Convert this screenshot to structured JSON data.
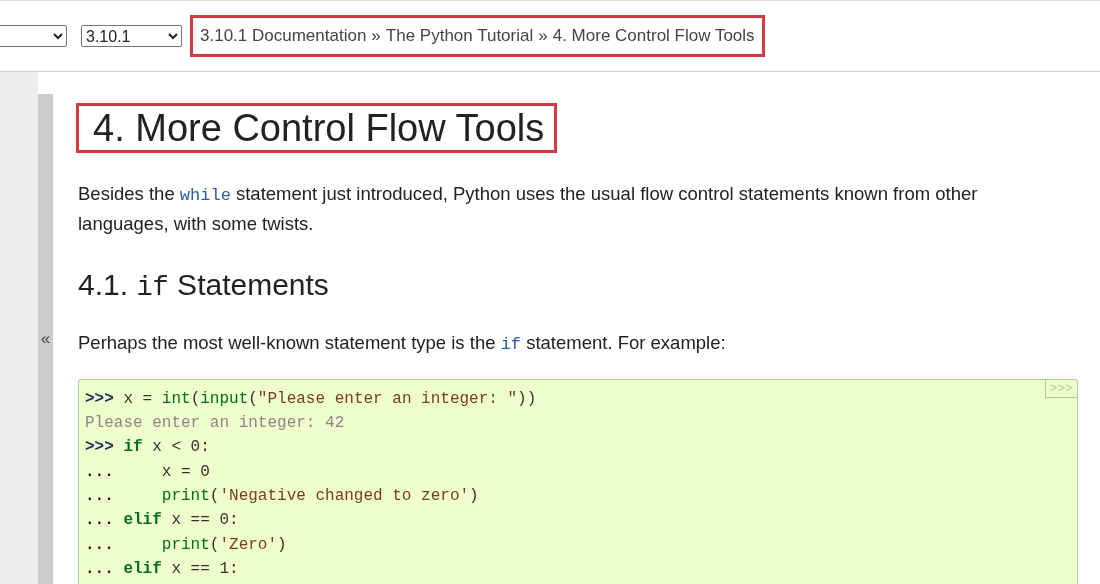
{
  "topbar": {
    "version_select": {
      "value": "3.10.1"
    },
    "breadcrumb": {
      "highlighted": true,
      "items": [
        "3.10.1 Documentation",
        "The Python Tutorial",
        "4. More Control Flow Tools"
      ],
      "separator": "»"
    }
  },
  "sidebar": {
    "collapse_button": "«"
  },
  "title": {
    "text": "4. More Control Flow Tools",
    "highlighted": true
  },
  "intro": [
    {
      "kind": "text",
      "text": "Besides the "
    },
    {
      "kind": "code",
      "text": "while"
    },
    {
      "kind": "text",
      "text": " statement just introduced, Python uses the usual flow control statements known from other languages, with some twists."
    }
  ],
  "section": {
    "number": "4.1.",
    "code": "if",
    "title": "Statements"
  },
  "para": [
    {
      "kind": "text",
      "text": "Perhaps the most well-known statement type is the "
    },
    {
      "kind": "code",
      "text": "if"
    },
    {
      "kind": "text",
      "text": " statement. For example:"
    }
  ],
  "code_block": {
    "copy_button": ">>>",
    "lines": [
      [
        {
          "kind": "prompt",
          "text": ">>> "
        },
        {
          "kind": "plain",
          "text": "x = "
        },
        {
          "kind": "builtin",
          "text": "int"
        },
        {
          "kind": "plain",
          "text": "("
        },
        {
          "kind": "builtin",
          "text": "input"
        },
        {
          "kind": "plain",
          "text": "("
        },
        {
          "kind": "string",
          "text": "\"Please enter an integer: \""
        },
        {
          "kind": "plain",
          "text": "))"
        }
      ],
      [
        {
          "kind": "output",
          "text": "Please enter an integer: 42"
        }
      ],
      [
        {
          "kind": "prompt",
          "text": ">>> "
        },
        {
          "kind": "keyword",
          "text": "if"
        },
        {
          "kind": "plain",
          "text": " x < 0:"
        }
      ],
      [
        {
          "kind": "dots",
          "text": "... "
        },
        {
          "kind": "plain",
          "text": "    x = 0"
        }
      ],
      [
        {
          "kind": "dots",
          "text": "...     "
        },
        {
          "kind": "builtin",
          "text": "print"
        },
        {
          "kind": "plain",
          "text": "("
        },
        {
          "kind": "string",
          "text": "'Negative changed to zero'"
        },
        {
          "kind": "plain",
          "text": ")"
        }
      ],
      [
        {
          "kind": "dots",
          "text": "... "
        },
        {
          "kind": "keyword",
          "text": "elif"
        },
        {
          "kind": "plain",
          "text": " x == 0:"
        }
      ],
      [
        {
          "kind": "dots",
          "text": "...     "
        },
        {
          "kind": "builtin",
          "text": "print"
        },
        {
          "kind": "plain",
          "text": "("
        },
        {
          "kind": "string",
          "text": "'Zero'"
        },
        {
          "kind": "plain",
          "text": ")"
        }
      ],
      [
        {
          "kind": "dots",
          "text": "... "
        },
        {
          "kind": "keyword",
          "text": "elif"
        },
        {
          "kind": "plain",
          "text": " x == 1:"
        }
      ]
    ]
  }
}
